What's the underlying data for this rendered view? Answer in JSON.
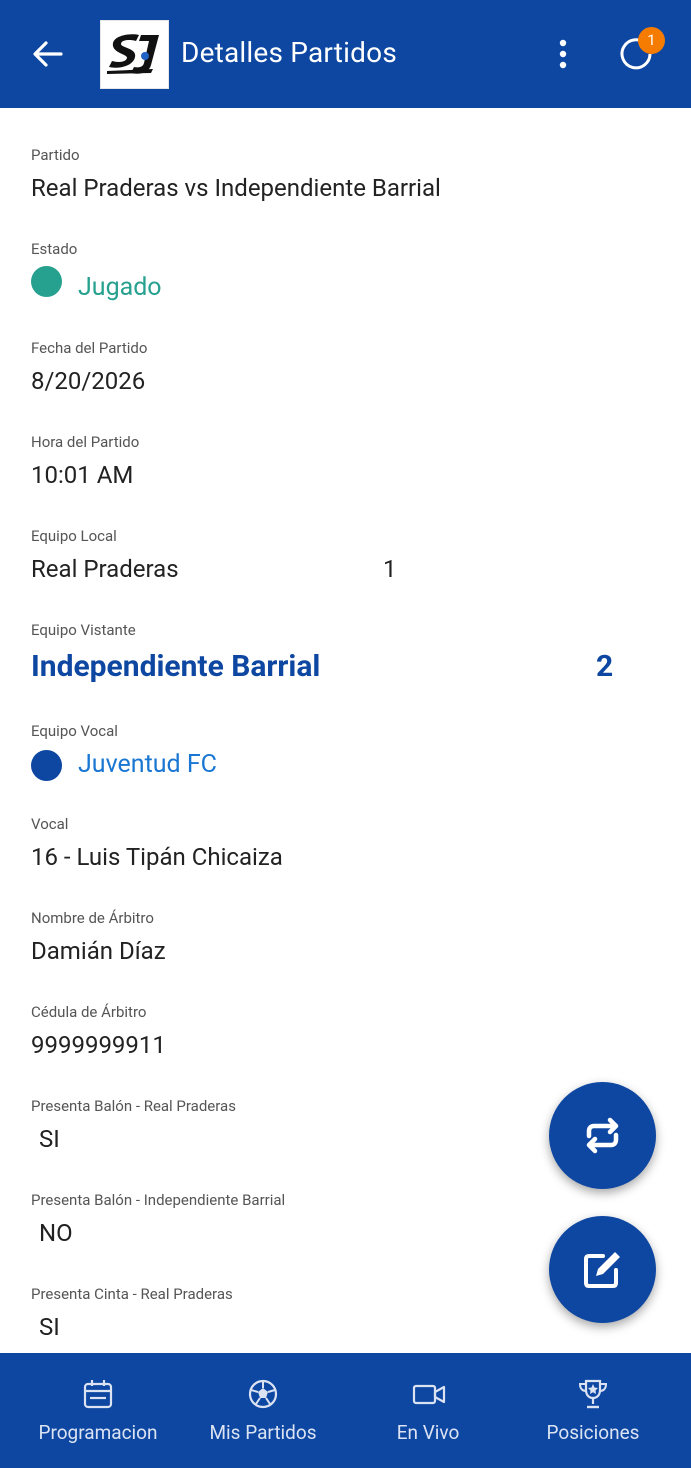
{
  "header": {
    "title": "Detalles Partidos",
    "badge_count": "1",
    "icons": [
      "arrow-back-icon",
      "sj-logo",
      "more-vert-icon",
      "sync-icon"
    ]
  },
  "details": {
    "partido": {
      "label": "Partido",
      "value": "Real Praderas vs Independiente Barrial"
    },
    "estado": {
      "label": "Estado",
      "value": "Jugado",
      "color": "#26a08f"
    },
    "fecha": {
      "label": "Fecha del Partido",
      "value": "8/20/2026"
    },
    "hora": {
      "label": "Hora del Partido",
      "value": "10:01 AM"
    },
    "local": {
      "label": "Equipo Local",
      "name": "Real Praderas",
      "score": "1"
    },
    "visitante": {
      "label": "Equipo Vistante",
      "name": "Independiente Barrial",
      "score": "2"
    },
    "vocal_equipo": {
      "label": "Equipo Vocal",
      "value": "Juventud FC",
      "color": "#1976d2"
    },
    "vocal": {
      "label": "Vocal",
      "value": "16 - Luis Tipán Chicaiza"
    },
    "arbitro": {
      "label": "Nombre de Árbitro",
      "value": "Damián Díaz"
    },
    "cedula": {
      "label": "Cédula de Árbitro",
      "value": "9999999911"
    },
    "balon_local": {
      "label": "Presenta Balón - Real Praderas",
      "value": "SI"
    },
    "balon_visita": {
      "label": "Presenta Balón - Independiente Barrial",
      "value": "NO"
    },
    "cinta_local": {
      "label": "Presenta Cinta - Real Praderas",
      "value": "SI"
    }
  },
  "fabs": {
    "swap_icon": "swap-icon",
    "edit_icon": "edit-icon"
  },
  "nav": {
    "items": [
      {
        "label": "Programacion",
        "icon": "calendar-icon"
      },
      {
        "label": "Mis Partidos",
        "icon": "soccer-ball-icon"
      },
      {
        "label": "En Vivo",
        "icon": "video-icon"
      },
      {
        "label": "Posiciones",
        "icon": "trophy-icon"
      }
    ]
  },
  "colors": {
    "primary": "#0d47a1",
    "accent": "#f57c00"
  }
}
